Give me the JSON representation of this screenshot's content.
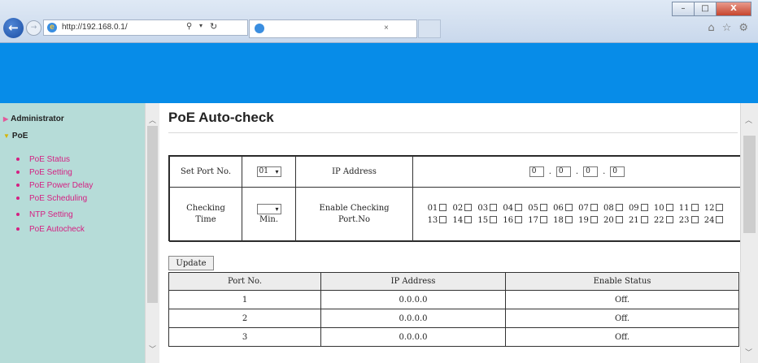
{
  "browser": {
    "url": "http://192.168.0.1/",
    "window_controls": [
      "–",
      "□",
      "X"
    ],
    "tab_title": "",
    "tab_close": "×",
    "icons": [
      "back-icon",
      "forward-icon",
      "search-icon",
      "refresh-icon",
      "home-icon",
      "favorites-icon",
      "settings-icon"
    ]
  },
  "colors": {
    "banner": "#078ce8",
    "sidebar": "#b6dcd8",
    "menu_link": "#d42082"
  },
  "sidebar": {
    "sections": [
      {
        "label": "Administrator"
      },
      {
        "label": "PoE",
        "items": [
          "PoE Status",
          "PoE Setting",
          "PoE Power Delay",
          "PoE Scheduling",
          "NTP Setting",
          "PoE Autocheck"
        ]
      }
    ]
  },
  "main": {
    "title": "PoE Auto-check",
    "form": {
      "set_port_label": "Set Port No.",
      "set_port_value": "01",
      "ip_label": "IP Address",
      "ip_octets": [
        "0",
        "0",
        "0",
        "0"
      ],
      "checking_time_label": "Checking Time",
      "checking_time_value": "",
      "checking_time_unit": "Min.",
      "enable_label": "Enable Checking Port.No",
      "ports": [
        "01",
        "02",
        "03",
        "04",
        "05",
        "06",
        "07",
        "08",
        "09",
        "10",
        "11",
        "12",
        "13",
        "14",
        "15",
        "16",
        "17",
        "18",
        "19",
        "20",
        "21",
        "22",
        "23",
        "24"
      ]
    },
    "update_button": "Update",
    "table": {
      "headers": [
        "Port No.",
        "IP Address",
        "Enable Status"
      ],
      "rows": [
        [
          "1",
          "0.0.0.0",
          "Off."
        ],
        [
          "2",
          "0.0.0.0",
          "Off."
        ],
        [
          "3",
          "0.0.0.0",
          "Off."
        ]
      ]
    }
  }
}
